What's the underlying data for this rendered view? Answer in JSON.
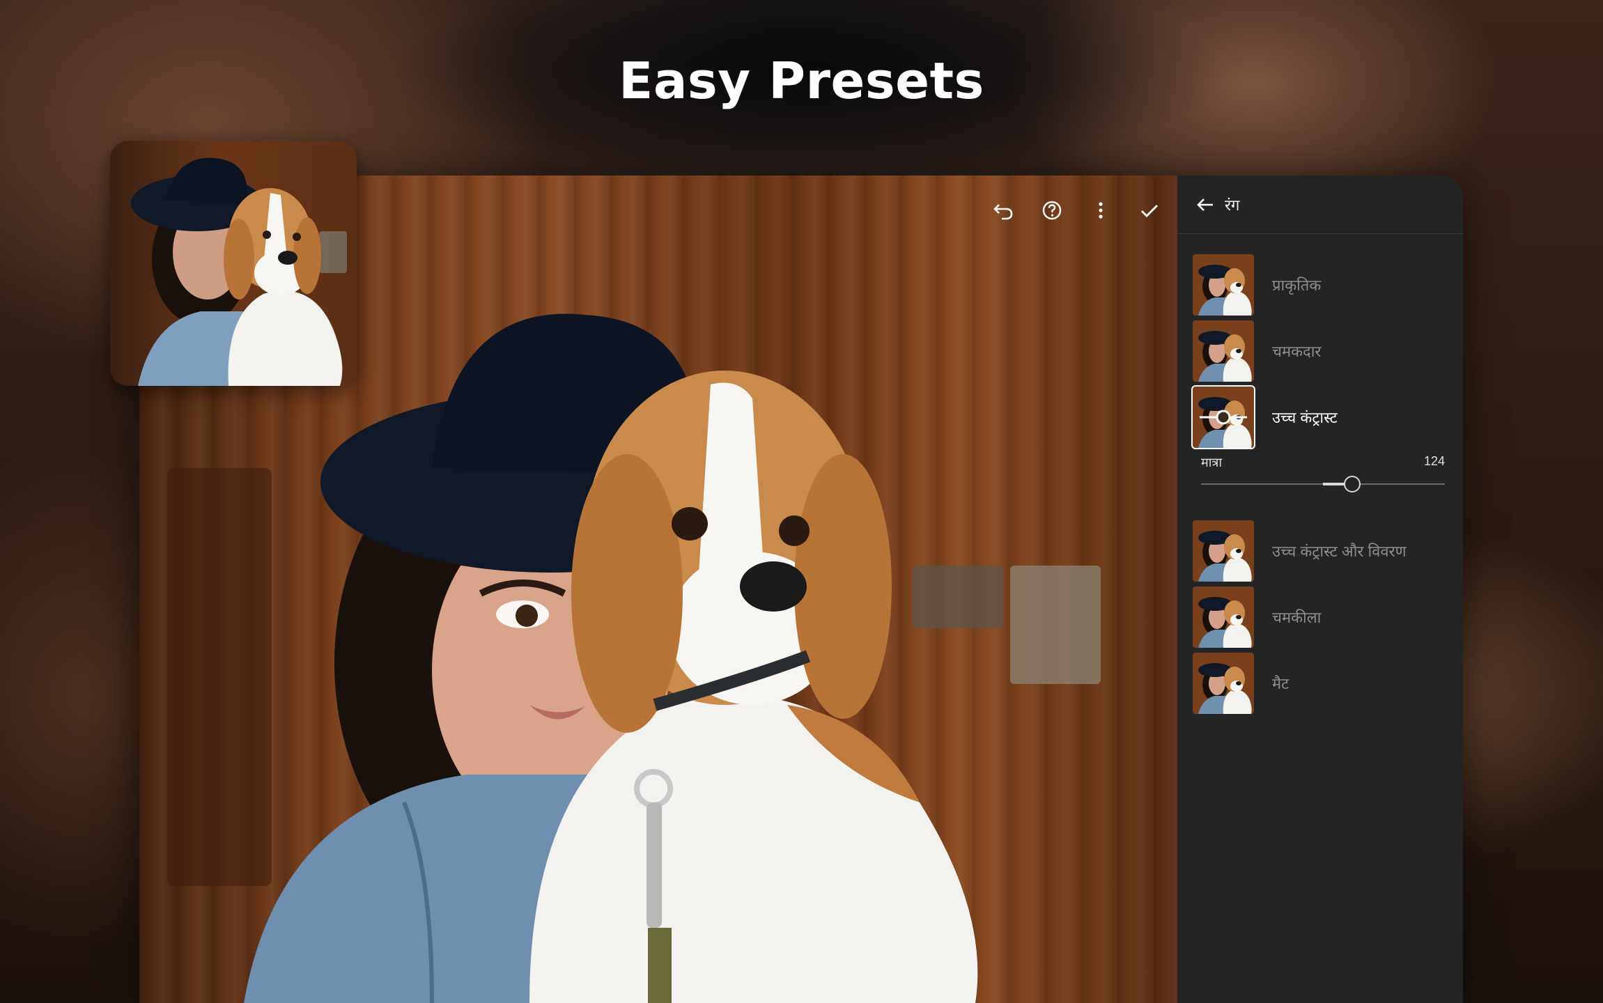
{
  "headline": "Easy Presets",
  "toolbar": {
    "undo_icon": "undo-icon",
    "help_icon": "help-circle-icon",
    "more_icon": "more-vertical-icon",
    "confirm_icon": "checkmark-icon"
  },
  "panel": {
    "back_icon": "arrow-left-icon",
    "title": "रंग",
    "presets": [
      {
        "label": "प्राकृतिक",
        "selected": false
      },
      {
        "label": "चमकदार",
        "selected": false
      },
      {
        "label": "उच्च कंट्रास्ट",
        "selected": true
      },
      {
        "label": "उच्च कंट्रास्ट और विवरण",
        "selected": false
      },
      {
        "label": "चमकीला",
        "selected": false
      },
      {
        "label": "मैट",
        "selected": false
      }
    ],
    "amount": {
      "label": "मात्रा",
      "value": "124",
      "level": 0.62
    }
  },
  "colors": {
    "panel_bg": "#242424",
    "accent": "#ffffff",
    "muted_text": "#8e8e8e"
  }
}
